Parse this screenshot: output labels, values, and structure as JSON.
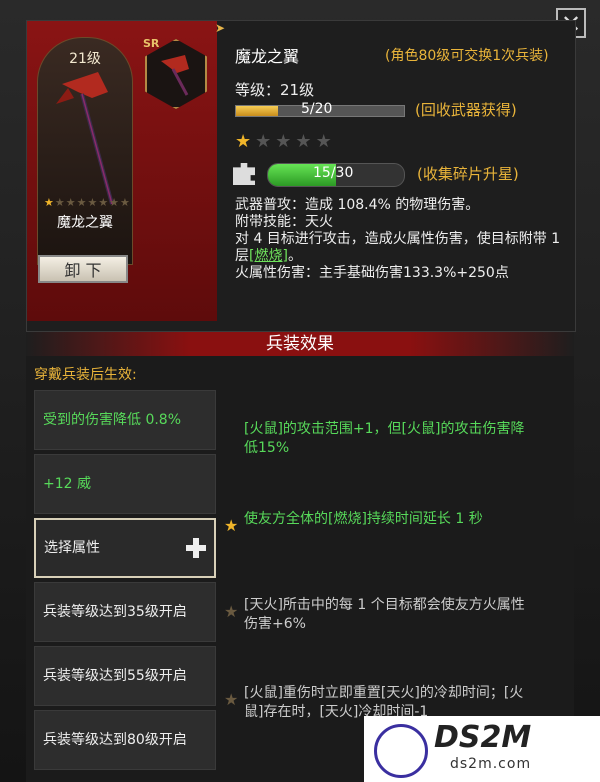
{
  "header": {
    "close_label": "✕"
  },
  "weapon": {
    "level_badge": "21级",
    "name": "魔龙之翼",
    "rarity": "SR",
    "unequip_label": "卸 下",
    "title": "魔龙之翼",
    "exchange_note": "(角色80级可交换1次兵装)",
    "level_text": "等级：21级",
    "level_progress": "5/20",
    "level_fraction": 0.25,
    "recycle_note": "(回收武器获得)",
    "star_rating": 1,
    "star_max": 5,
    "fragment_progress": "15/30",
    "fragment_fraction": 0.5,
    "collect_note": "(收集碎片升星)",
    "desc": {
      "line1": "武器普攻：造成 108.4% 的物理伤害。",
      "line2": "附带技能：天火",
      "line3a": "对 4 目标进行攻击，造成火属性伤害，使目标附带 1 层",
      "line3b": "[燃烧]",
      "line3c": "。",
      "line4": "火属性伤害：主手基础伤害133.3%+250点"
    }
  },
  "effects": {
    "header": "兵装效果",
    "hint": "穿戴兵装后生效:",
    "slots": [
      {
        "label": "受到的伤害降低 0.8%"
      },
      {
        "label": "+12 威"
      },
      {
        "label": "选择属性"
      },
      {
        "label": "兵装等级达到35级开启"
      },
      {
        "label": "兵装等级达到55级开启"
      },
      {
        "label": "兵装等级达到80级开启"
      }
    ],
    "list": [
      {
        "text": "[火鼠]的攻击范围+1，但[火鼠]的攻击伤害降低15%"
      },
      {
        "text": "使友方全体的[燃烧]持续时间延长 1 秒"
      },
      {
        "text": "[天火]所击中的每 1 个目标都会使友方火属性伤害+6%"
      },
      {
        "text": "[火鼠]重伤时立即重置[天火]的冷却时间；[火鼠]存在时，[天火]冷却时间-1"
      }
    ]
  },
  "watermark": {
    "brand": "DS2M",
    "url": "ds2m.com"
  },
  "colors": {
    "accent_gold": "#e9b43a",
    "effect_green": "#57d95a",
    "banner_red": "#8a1414"
  }
}
